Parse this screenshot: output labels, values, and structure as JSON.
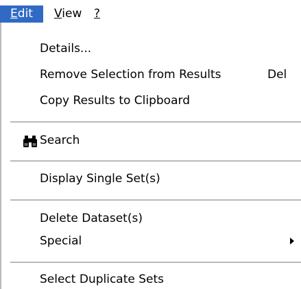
{
  "menubar": {
    "items": [
      {
        "label_mnemonic": "E",
        "label_rest": "dit",
        "active": true
      },
      {
        "label_mnemonic": "V",
        "label_rest": "iew",
        "active": false
      },
      {
        "label_mnemonic": "?",
        "label_rest": "",
        "active": false
      }
    ]
  },
  "edit_menu": {
    "groups": [
      {
        "items": [
          {
            "label": "Details..."
          },
          {
            "label": "Remove Selection from Results",
            "shortcut": "Del"
          },
          {
            "label": "Copy Results to Clipboard"
          }
        ]
      },
      {
        "items": [
          {
            "label": "Search",
            "icon": "binoculars-icon"
          }
        ]
      },
      {
        "items": [
          {
            "label": "Display Single Set(s)"
          }
        ]
      },
      {
        "items": [
          {
            "label": "Delete Dataset(s)"
          },
          {
            "label": "Special",
            "has_submenu": true
          }
        ]
      },
      {
        "items": [
          {
            "label": "Select Duplicate Sets"
          }
        ]
      }
    ]
  },
  "colors": {
    "menubar_active_bg": "#316ac5",
    "menubar_active_fg": "#ffffff",
    "separator": "#b9b9b9",
    "text": "#000000",
    "background": "#ffffff"
  }
}
